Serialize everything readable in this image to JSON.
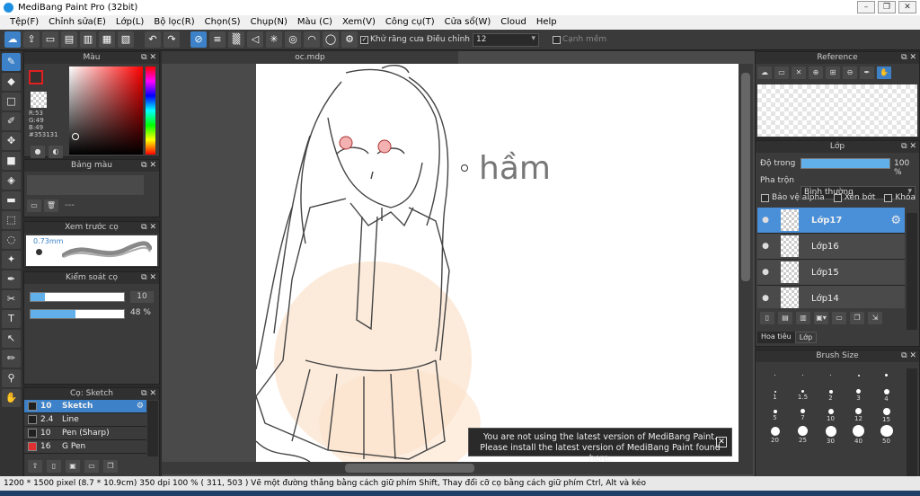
{
  "title": "MediBang Paint Pro (32bit)",
  "window_buttons": [
    "–",
    "❐",
    "✕"
  ],
  "menu": [
    "Tệp(F)",
    "Chỉnh sửa(E)",
    "Lớp(L)",
    "Bộ lọc(R)",
    "Chọn(S)",
    "Chụp(N)",
    "Màu (C)",
    "Xem(V)",
    "Công cụ(T)",
    "Cửa sổ(W)",
    "Cloud",
    "Help"
  ],
  "toolbar": {
    "antialias_label": "Khử răng cưa",
    "adjust_label": "Điều chỉnh",
    "adjust_value": "12",
    "smooth_label": "Cạnh mềm"
  },
  "color_panel": {
    "title": "Màu",
    "r": "R:53",
    "g": "G:49",
    "b": "B:49",
    "hex": "#353131",
    "accent": "#353131"
  },
  "palette_panel": {
    "title": "Bảng màu",
    "dash": "---"
  },
  "preview_panel": {
    "title": "Xem trước cọ",
    "size": "0.73mm"
  },
  "control_panel": {
    "title": "Kiểm soát cọ",
    "size_value": "10",
    "opacity_value": "48 %",
    "opacity": 0.48,
    "size_fill": 0.15
  },
  "brush_panel": {
    "title": "Cọ: Sketch",
    "items": [
      {
        "size": "10",
        "name": "Sketch",
        "color": "#202020"
      },
      {
        "size": "2.4",
        "name": "Line",
        "color": "#202020"
      },
      {
        "size": "10",
        "name": "Pen (Sharp)",
        "color": "#202020"
      },
      {
        "size": "16",
        "name": "G Pen",
        "color": "#e03030"
      }
    ]
  },
  "canvas": {
    "tab": "oc.mdp",
    "sketch_text": "hầm"
  },
  "notice": {
    "line1": "You are not using the latest version of MediBang Paint.",
    "line2": "Please install the latest version of MediBang Paint found here.",
    "close": "✕"
  },
  "reference_panel": {
    "title": "Reference"
  },
  "layer_panel": {
    "title": "Lớp",
    "opacity_label": "Độ trong",
    "opacity_value": "100 %",
    "opacity": 1.0,
    "blend_label": "Pha trộn",
    "blend_value": "Bình thường",
    "protect_alpha": "Bảo vệ alpha",
    "clipping": "Xén bớt",
    "lock": "Khóa",
    "layers": [
      "Lớp17",
      "Lớp16",
      "Lớp15",
      "Lớp14"
    ],
    "tabs": [
      "Hoa tiêu",
      "Lớp"
    ]
  },
  "brushsize_panel": {
    "title": "Brush Size",
    "sizes": [
      "",
      "",
      "",
      "",
      "",
      "1",
      "1.5",
      "2",
      "3",
      "4",
      "5",
      "7",
      "10",
      "12",
      "15",
      "20",
      "25",
      "30",
      "40",
      "50"
    ]
  },
  "status": {
    "text": "1200 * 1500 pixel   (8.7 * 10.9cm)   350 dpi   100 %   ( 311, 503 )   Vẽ một đường thẳng bằng cách giữ phím Shift, Thay đổi cỡ cọ bằng cách giữ phím Ctrl, Alt và kéo"
  }
}
